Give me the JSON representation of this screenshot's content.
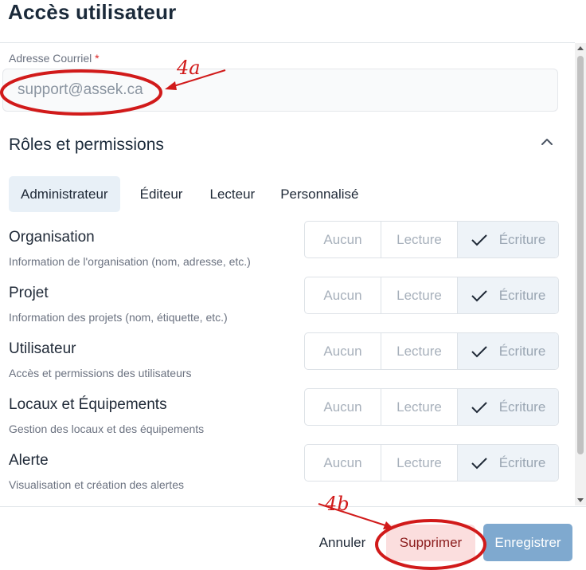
{
  "dialog": {
    "title": "Accès utilisateur"
  },
  "email": {
    "label": "Adresse Courriel",
    "required_mark": "*",
    "value": "support@assek.ca"
  },
  "roles": {
    "title": "Rôles et permissions",
    "collapse_icon": "chevron-up-icon",
    "tabs": [
      {
        "label": "Administrateur",
        "active": true
      },
      {
        "label": "Éditeur",
        "active": false
      },
      {
        "label": "Lecteur",
        "active": false
      },
      {
        "label": "Personnalisé",
        "active": false
      }
    ]
  },
  "permissions": [
    {
      "name": "Organisation",
      "description": "Information de l'organisation (nom, adresse, etc.)",
      "options": [
        "Aucun",
        "Lecture",
        "Écriture"
      ],
      "selected": "Écriture"
    },
    {
      "name": "Projet",
      "description": "Information des projets (nom, étiquette, etc.)",
      "options": [
        "Aucun",
        "Lecture",
        "Écriture"
      ],
      "selected": "Écriture"
    },
    {
      "name": "Utilisateur",
      "description": "Accès et permissions des utilisateurs",
      "options": [
        "Aucun",
        "Lecture",
        "Écriture"
      ],
      "selected": "Écriture"
    },
    {
      "name": "Locaux et Équipements",
      "description": "Gestion des locaux et des équipements",
      "options": [
        "Aucun",
        "Lecture",
        "Écriture"
      ],
      "selected": "Écriture"
    },
    {
      "name": "Alerte",
      "description": "Visualisation et création des alertes",
      "options": [
        "Aucun",
        "Lecture",
        "Écriture"
      ],
      "selected": "Écriture"
    }
  ],
  "footer": {
    "cancel": "Annuler",
    "delete": "Supprimer",
    "save": "Enregistrer"
  },
  "annotations": {
    "email_mark": "4a",
    "delete_mark": "4b",
    "color": "#d11a1a"
  }
}
